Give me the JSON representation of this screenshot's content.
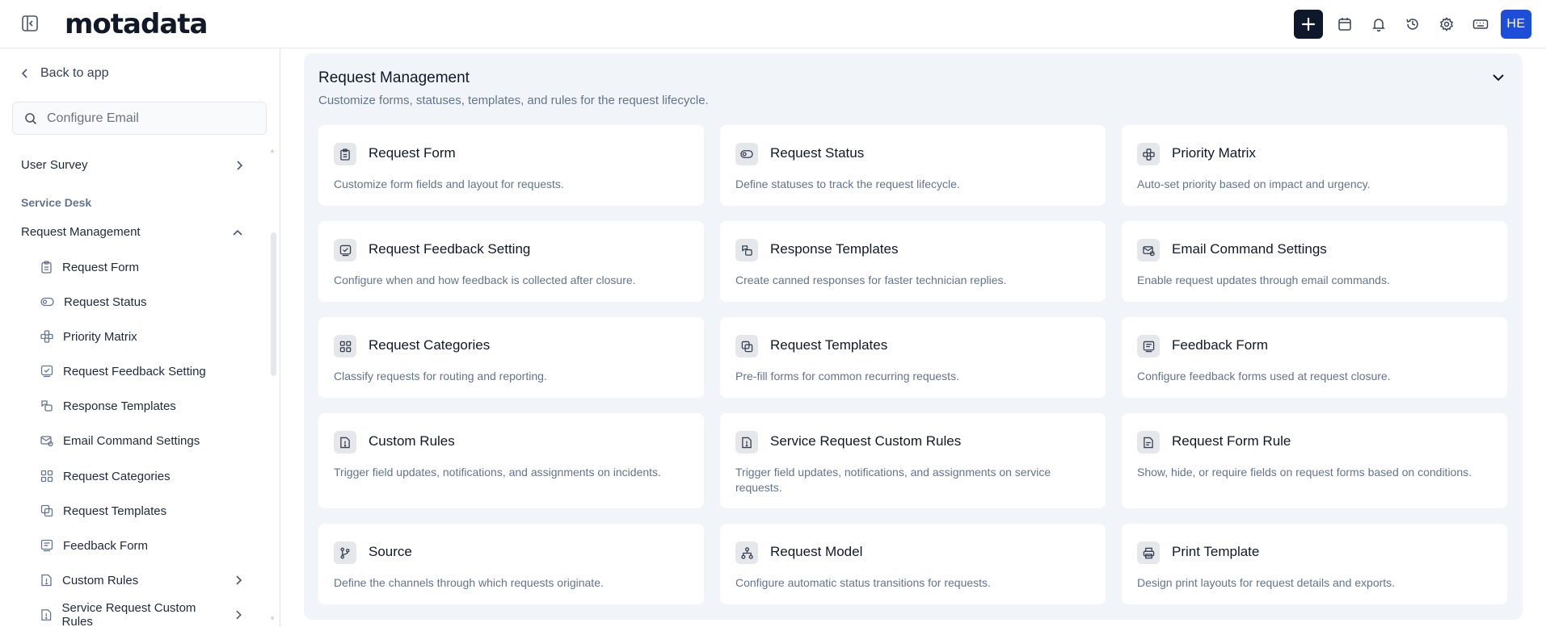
{
  "header": {
    "logo": "motadata",
    "avatar_initials": "HE",
    "icons": [
      "add-icon",
      "calendar-icon",
      "bell-icon",
      "history-icon",
      "gear-icon",
      "keyboard-icon"
    ]
  },
  "sidebar": {
    "back_label": "Back to app",
    "search_placeholder": "Configure Email",
    "user_survey": "User Survey",
    "section_label": "Service Desk",
    "request_management": "Request Management",
    "items": [
      {
        "label": "Request Form",
        "icon": "clipboard-icon"
      },
      {
        "label": "Request Status",
        "icon": "toggle-icon"
      },
      {
        "label": "Priority Matrix",
        "icon": "matrix-icon"
      },
      {
        "label": "Request Feedback Setting",
        "icon": "feedback-icon"
      },
      {
        "label": "Response Templates",
        "icon": "response-icon"
      },
      {
        "label": "Email Command Settings",
        "icon": "email-command-icon"
      },
      {
        "label": "Request Categories",
        "icon": "grid-icon"
      },
      {
        "label": "Request Templates",
        "icon": "copy-icon"
      },
      {
        "label": "Feedback Form",
        "icon": "form-icon"
      },
      {
        "label": "Custom Rules",
        "icon": "rule-icon"
      },
      {
        "label": "Service Request Custom Rules",
        "icon": "rule-icon"
      }
    ]
  },
  "main": {
    "title": "Request Management",
    "subtitle": "Customize forms, statuses, templates, and rules for the request lifecycle.",
    "cards": [
      {
        "title": "Request Form",
        "desc": "Customize form fields and layout for requests."
      },
      {
        "title": "Request Status",
        "desc": "Define statuses to track the request lifecycle."
      },
      {
        "title": "Priority Matrix",
        "desc": "Auto-set priority based on impact and urgency."
      },
      {
        "title": "Request Feedback Setting",
        "desc": "Configure when and how feedback is collected after closure."
      },
      {
        "title": "Response Templates",
        "desc": "Create canned responses for faster technician replies."
      },
      {
        "title": "Email Command Settings",
        "desc": "Enable request updates through email commands."
      },
      {
        "title": "Request Categories",
        "desc": "Classify requests for routing and reporting."
      },
      {
        "title": "Request Templates",
        "desc": "Pre-fill forms for common recurring requests."
      },
      {
        "title": "Feedback Form",
        "desc": "Configure feedback forms used at request closure."
      },
      {
        "title": "Custom Rules",
        "desc": "Trigger field updates, notifications, and assignments on incidents."
      },
      {
        "title": "Service Request Custom Rules",
        "desc": "Trigger field updates, notifications, and assignments on service requests."
      },
      {
        "title": "Request Form Rule",
        "desc": "Show, hide, or require fields on request forms based on conditions."
      },
      {
        "title": "Source",
        "desc": "Define the channels through which requests originate."
      },
      {
        "title": "Request Model",
        "desc": "Configure automatic status transitions for requests."
      },
      {
        "title": "Print Template",
        "desc": "Design print layouts for request details and exports."
      }
    ]
  }
}
